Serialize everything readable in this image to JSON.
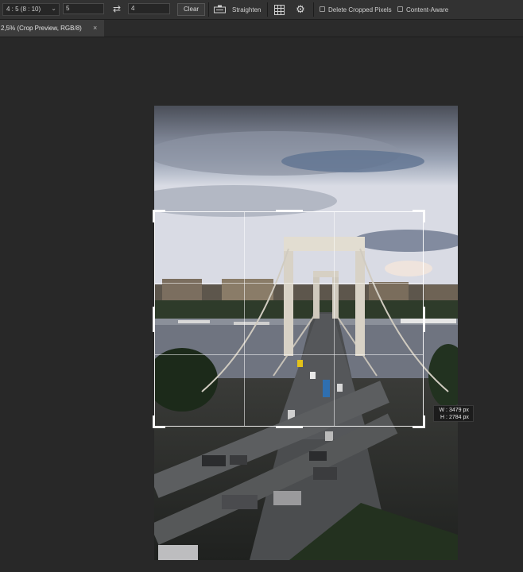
{
  "options_bar": {
    "ratio_preset": "4 : 5 (8 : 10)",
    "width_value": "5",
    "height_value": "4",
    "clear_label": "Clear",
    "straighten_label": "Straighten",
    "delete_cropped_label": "Delete Cropped Pixels",
    "delete_cropped_checked": false,
    "content_aware_label": "Content-Aware",
    "content_aware_checked": false
  },
  "tabs": [
    {
      "label": "2,5% (Crop Preview, RGB/8)",
      "close": "×"
    }
  ],
  "crop_tooltip": {
    "w_label": "W :",
    "w_value": "3479 px",
    "h_label": "H :",
    "h_value": "2784 px"
  },
  "colors": {
    "ui_bg": "#282828",
    "options_bar": "#323232",
    "tab_active": "#3c3c3c",
    "crop_border": "#ffffff"
  },
  "icons": [
    "swap-icon",
    "straighten-level-icon",
    "grid-overlay-icon",
    "gear-icon",
    "chevron-down-icon",
    "close-icon"
  ]
}
